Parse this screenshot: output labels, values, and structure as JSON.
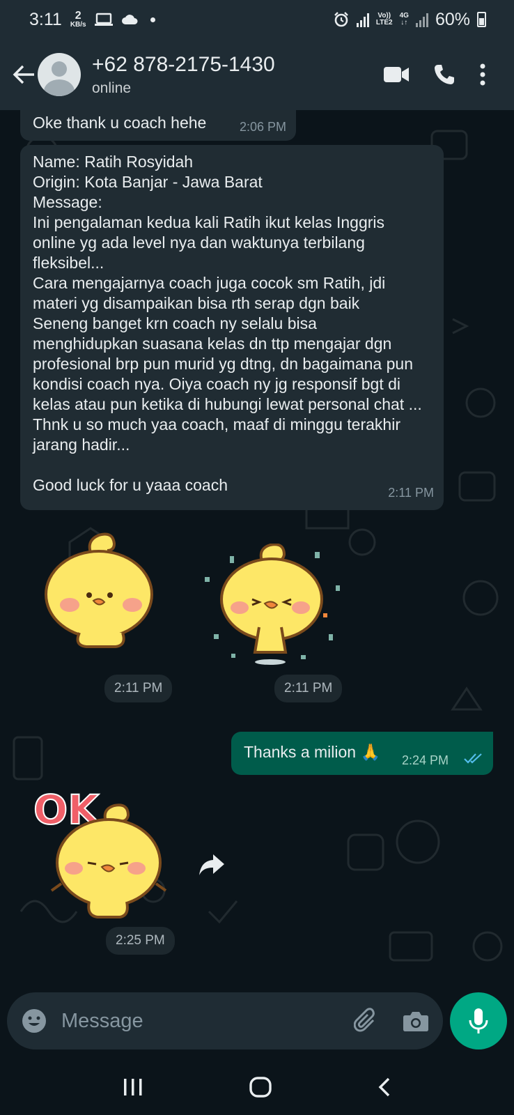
{
  "status_bar": {
    "time": "3:11",
    "speed_value": "2",
    "speed_unit": "KB/s",
    "volte_top": "Vo))",
    "volte_bottom": "LTE2",
    "network": "4G",
    "battery": "60%"
  },
  "header": {
    "contact_name": "+62 878-2175-1430",
    "contact_status": "online"
  },
  "messages": [
    {
      "direction": "in",
      "text": "Oke thank u coach hehe",
      "time": "2:06 PM"
    },
    {
      "direction": "in",
      "text": "Name: Ratih Rosyidah\nOrigin: Kota Banjar - Jawa Barat\nMessage:\nIni pengalaman kedua kali Ratih ikut kelas Inggris online yg ada level nya dan waktunya terbilang fleksibel...\nCara mengajarnya coach juga cocok sm Ratih, jdi materi yg disampaikan bisa rth serap dgn baik\nSeneng banget krn coach ny selalu bisa menghidupkan suasana kelas dn ttp mengajar dgn profesional brp pun murid yg dtng, dn bagaimana pun kondisi coach nya. Oiya coach ny jg responsif bgt di kelas atau pun ketika di hubungi lewat personal chat ... Thnk u so much yaa coach, maaf di minggu terakhir jarang hadir...\n\nGood luck for u yaaa coach",
      "time": "2:11 PM"
    },
    {
      "direction": "in",
      "type": "sticker",
      "sticker": "chick-standing",
      "time": "2:11 PM"
    },
    {
      "direction": "in",
      "type": "sticker",
      "sticker": "chick-celebrating",
      "time": "2:11 PM"
    },
    {
      "direction": "out",
      "text": "Thanks a milion 🙏",
      "time": "2:24 PM",
      "read_receipt": "double-check-blue"
    },
    {
      "direction": "in",
      "type": "sticker",
      "sticker": "chick-ok",
      "sticker_text": "OK",
      "time": "2:25 PM"
    }
  ],
  "input": {
    "placeholder": "Message"
  },
  "colors": {
    "header_bg": "#1f2c34",
    "chat_bg": "#0b141a",
    "incoming_bubble": "#202c33",
    "outgoing_bubble": "#005c4b",
    "accent": "#00a884",
    "read_tick": "#53bdeb"
  },
  "icons": {
    "back": "arrow-left-icon",
    "video": "video-call-icon",
    "call": "phone-icon",
    "menu": "more-vertical-icon",
    "emoji": "emoji-icon",
    "attach": "paperclip-icon",
    "camera": "camera-icon",
    "mic": "microphone-icon",
    "forward": "forward-icon"
  }
}
